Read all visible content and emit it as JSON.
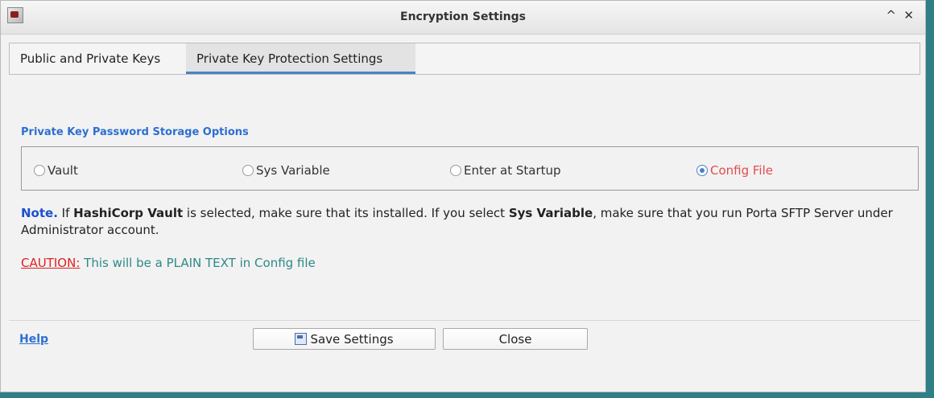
{
  "window": {
    "title": "Encryption Settings"
  },
  "titlebar": {
    "maximize": "^",
    "close": "✕"
  },
  "tabs": [
    {
      "label": "Public and Private Keys",
      "selected": false
    },
    {
      "label": "Private Key Protection Settings",
      "selected": true
    }
  ],
  "section": {
    "title": "Private Key Password Storage Options"
  },
  "options": [
    {
      "label": "Vault",
      "selected": false
    },
    {
      "label": "Sys Variable",
      "selected": false
    },
    {
      "label": "Enter at Startup",
      "selected": false
    },
    {
      "label": "Config File",
      "selected": true
    }
  ],
  "note": {
    "label": "Note.",
    "text1": " If ",
    "vault": "HashiCorp Vault",
    "text2": " is selected, make sure that its installed. If you select ",
    "sys": "Sys Variable",
    "text3": ", make sure that you run Porta SFTP Server under Administrator account."
  },
  "caution": {
    "label": "CAUTION:",
    "text": " This will be a PLAIN TEXT in Config file"
  },
  "footer": {
    "help": "Help",
    "save": "Save Settings",
    "close": "Close"
  },
  "colors": {
    "accent": "#2c6fd1",
    "selected_option": "#e24c4c",
    "caution": "#e02020",
    "caution_text": "#2d8a86"
  }
}
